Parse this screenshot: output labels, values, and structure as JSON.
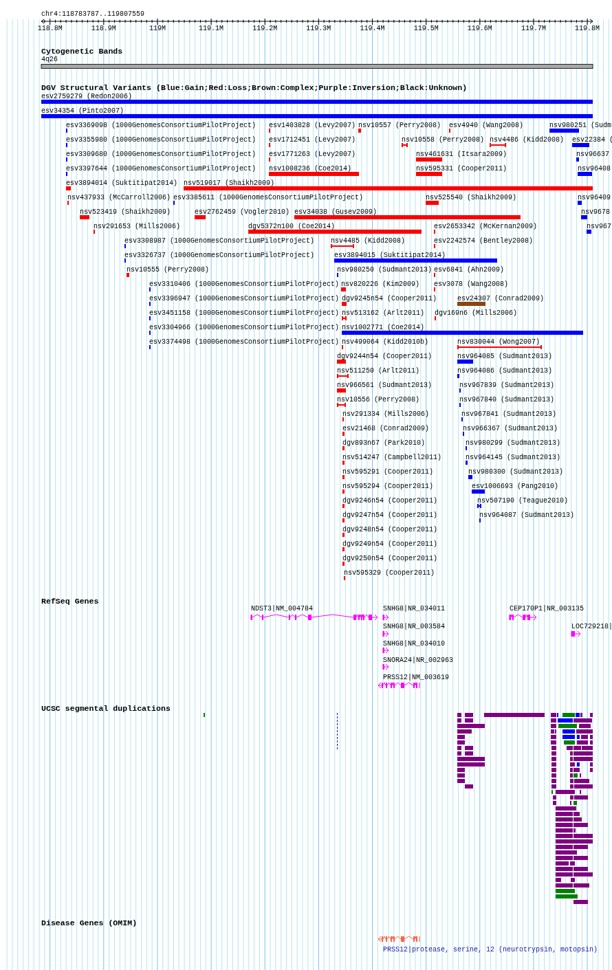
{
  "ruler": {
    "title": "chr4:118783787..119807559",
    "ticks": [
      "118.8M",
      "118.9M",
      "119M",
      "119.1M",
      "119.2M",
      "119.3M",
      "119.4M",
      "119.5M",
      "119.6M",
      "119.7M",
      "119.8M"
    ]
  },
  "cytogenetic_bands": {
    "title": "Cytogenetic Bands",
    "band": "4q26"
  },
  "dgv": {
    "title": "DGV Structural Variants (Blue:Gain;Red:Loss;Brown:Complex;Purple:Inversion;Black:Unknown)",
    "rows": [
      {
        "variants": [
          {
            "label": "esv2759279 (Redon2006)",
            "color": "#0000ff"
          }
        ]
      },
      {
        "variants": [
          {
            "label": "esv34354 (Pinto2007)",
            "color": "#0000ff"
          }
        ]
      },
      {
        "variants": [
          {
            "label": "esv3369098 (1000GenomesConsortiumPilotProject)",
            "color": "#0000ff"
          },
          {
            "label": "esv1403828 (Levy2007)",
            "color": "#ff0000"
          },
          {
            "label": "nsv10557 (Perry2008)",
            "color": "#ff0000"
          },
          {
            "label": "esv4940 (Wang2008)",
            "color": "#ff0000"
          },
          {
            "label": "nsv980251 (Sudm",
            "color": "#0000ff"
          }
        ]
      },
      {
        "variants": [
          {
            "label": "esv3355980 (1000GenomesConsortiumPilotProject)",
            "color": "#0000ff"
          },
          {
            "label": "esv1712451 (Levy2007)",
            "color": "#ff0000"
          },
          {
            "label": "nsv10558 (Perry2008)",
            "color": "#ff0000"
          },
          {
            "label": "nsv4486 (Kidd2008)",
            "color": "#ff0000"
          },
          {
            "label": "esv22384 (",
            "color": "#0000ff"
          }
        ]
      },
      {
        "variants": [
          {
            "label": "esv3309680 (1000GenomesConsortiumPilotProject)",
            "color": "#0000ff"
          },
          {
            "label": "esv1771263 (Levy2007)",
            "color": "#ff0000"
          },
          {
            "label": "nsv461631 (Itsara2009)",
            "color": "#ff0000"
          },
          {
            "label": "nsv96637",
            "color": "#0000ff"
          }
        ]
      },
      {
        "variants": [
          {
            "label": "esv3397644 (1000GenomesConsortiumPilotProject)",
            "color": "#0000ff"
          },
          {
            "label": "nsv1008236 (Coe2014)",
            "color": "#ff0000"
          },
          {
            "label": "nsv595331 (Cooper2011)",
            "color": "#ff0000"
          },
          {
            "label": "nsv96408",
            "color": "#0000ff"
          }
        ]
      },
      {
        "variants": [
          {
            "label": "esv3894014 (Suktitipat2014)",
            "color": "#ff0000"
          },
          {
            "label": "nsv519017 (Shaikh2009)",
            "color": "#ff0000"
          }
        ]
      },
      {
        "variants": [
          {
            "label": "nsv437933 (McCarroll2006)",
            "color": "#ff0000"
          },
          {
            "label": "esv3385611 (1000GenomesConsortiumPilotProject)",
            "color": "#0000ff"
          },
          {
            "label": "nsv525540 (Shaikh2009)",
            "color": "#ff0000"
          },
          {
            "label": "nsv96409",
            "color": "#0000ff"
          }
        ]
      },
      {
        "variants": [
          {
            "label": "nsv523419 (Shaikh2009)",
            "color": "#ff0000"
          },
          {
            "label": "esv2762459 (Vogler2010)",
            "color": "#ff0000"
          },
          {
            "label": "esv34038 (Gusev2009)",
            "color": "#ff0000"
          },
          {
            "label": "nsv9678",
            "color": "#0000ff"
          }
        ]
      },
      {
        "variants": [
          {
            "label": "nsv291653 (Mills2006)",
            "color": "#ff0000"
          },
          {
            "label": "dgv5372n100 (Coe2014)",
            "color": "#ff0000"
          },
          {
            "label": "esv2653342 (McKernan2009)",
            "color": "#ff0000"
          },
          {
            "label": "nsv967",
            "color": "#0000ff"
          }
        ]
      },
      {
        "variants": [
          {
            "label": "esv3308987 (1000GenomesConsortiumPilotProject)",
            "color": "#0000ff"
          },
          {
            "label": "nsv4485 (Kidd2008)",
            "color": "#ff0000"
          },
          {
            "label": "esv2242574 (Bentley2008)",
            "color": "#ff0000"
          }
        ]
      },
      {
        "variants": [
          {
            "label": "esv3326737 (1000GenomesConsortiumPilotProject)",
            "color": "#0000ff"
          },
          {
            "label": "esv3894015 (Suktitipat2014)",
            "color": "#0000ff"
          }
        ]
      },
      {
        "variants": [
          {
            "label": "nsv10555 (Perry2008)",
            "color": "#ff0000"
          },
          {
            "label": "nsv980250 (Sudmant2013)",
            "color": "#0000ff"
          },
          {
            "label": "esv6841 (Ahn2009)",
            "color": "#ff0000"
          }
        ]
      },
      {
        "variants": [
          {
            "label": "esv3310406 (1000GenomesConsortiumPilotProject)",
            "color": "#0000ff"
          },
          {
            "label": "nsv820226 (Kim2009)",
            "color": "#ff0000"
          },
          {
            "label": "esv3078 (Wang2008)",
            "color": "#ff0000"
          }
        ]
      },
      {
        "variants": [
          {
            "label": "esv3396947 (1000GenomesConsortiumPilotProject)",
            "color": "#0000ff"
          },
          {
            "label": "dgv9245n54 (Cooper2011)",
            "color": "#ff0000"
          },
          {
            "label": "esv24307 (Conrad2009)",
            "color": "#8b4513"
          }
        ]
      },
      {
        "variants": [
          {
            "label": "esv3451158 (1000GenomesConsortiumPilotProject)",
            "color": "#0000ff"
          },
          {
            "label": "nsv513162 (Arlt2011)",
            "color": "#ff0000"
          },
          {
            "label": "dgv169n6 (Mills2006)",
            "color": "#ff0000"
          }
        ]
      },
      {
        "variants": [
          {
            "label": "esv3304966 (1000GenomesConsortiumPilotProject)",
            "color": "#0000ff"
          },
          {
            "label": "nsv1002771 (Coe2014)",
            "color": "#0000ff"
          }
        ]
      },
      {
        "variants": [
          {
            "label": "esv3374498 (1000GenomesConsortiumPilotProject)",
            "color": "#0000ff"
          },
          {
            "label": "nsv499064 (Kidd2010b)",
            "color": "#ff0000"
          },
          {
            "label": "nsv830044 (Wong2007)",
            "color": "#ff0000"
          }
        ]
      },
      {
        "variants": [
          {
            "label": "dgv9244n54 (Cooper2011)",
            "color": "#ff0000"
          },
          {
            "label": "nsv964085 (Sudmant2013)",
            "color": "#0000ff"
          }
        ]
      },
      {
        "variants": [
          {
            "label": "nsv511250 (Arlt2011)",
            "color": "#ff0000"
          },
          {
            "label": "nsv964086 (Sudmant2013)",
            "color": "#0000ff"
          }
        ]
      },
      {
        "variants": [
          {
            "label": "nsv966561 (Sudmant2013)",
            "color": "#ff0000"
          },
          {
            "label": "nsv967839 (Sudmant2013)",
            "color": "#0000ff"
          }
        ]
      },
      {
        "variants": [
          {
            "label": "nsv10556 (Perry2008)",
            "color": "#ff0000"
          },
          {
            "label": "nsv967840 (Sudmant2013)",
            "color": "#0000ff"
          }
        ]
      },
      {
        "variants": [
          {
            "label": "nsv291334 (Mills2006)",
            "color": "#ff0000"
          },
          {
            "label": "nsv967841 (Sudmant2013)",
            "color": "#0000ff"
          }
        ]
      },
      {
        "variants": [
          {
            "label": "esv21468 (Conrad2009)",
            "color": "#ff0000"
          },
          {
            "label": "nsv966367 (Sudmant2013)",
            "color": "#0000ff"
          }
        ]
      },
      {
        "variants": [
          {
            "label": "dgv893n67 (Park2010)",
            "color": "#ff0000"
          },
          {
            "label": "nsv980299 (Sudmant2013)",
            "color": "#0000ff"
          }
        ]
      },
      {
        "variants": [
          {
            "label": "nsv514247 (Campbell2011)",
            "color": "#ff0000"
          },
          {
            "label": "nsv964145 (Sudmant2013)",
            "color": "#0000ff"
          }
        ]
      },
      {
        "variants": [
          {
            "label": "nsv595291 (Cooper2011)",
            "color": "#ff0000"
          },
          {
            "label": "nsv980300 (Sudmant2013)",
            "color": "#0000ff"
          }
        ]
      },
      {
        "variants": [
          {
            "label": "nsv595294 (Cooper2011)",
            "color": "#ff0000"
          },
          {
            "label": "esv1006693 (Pang2010)",
            "color": "#0000ff"
          }
        ]
      },
      {
        "variants": [
          {
            "label": "dgv9246n54 (Cooper2011)",
            "color": "#ff0000"
          },
          {
            "label": "nsv507190 (Teague2010)",
            "color": "#0000ff"
          }
        ]
      },
      {
        "variants": [
          {
            "label": "dgv9247n54 (Cooper2011)",
            "color": "#ff0000"
          },
          {
            "label": "nsv964087 (Sudmant2013)",
            "color": "#0000ff"
          }
        ]
      },
      {
        "variants": [
          {
            "label": "dgv9248n54 (Cooper2011)",
            "color": "#ff0000"
          }
        ]
      },
      {
        "variants": [
          {
            "label": "dgv9249n54 (Cooper2011)",
            "color": "#ff0000"
          }
        ]
      },
      {
        "variants": [
          {
            "label": "dgv9250n54 (Cooper2011)",
            "color": "#ff0000"
          }
        ]
      },
      {
        "variants": [
          {
            "label": "nsv595329 (Cooper2011)",
            "color": "#ff0000"
          }
        ]
      }
    ]
  },
  "refseq_genes": {
    "title": "RefSeq Genes",
    "genes": [
      {
        "label": "NDST3|NM_004784"
      },
      {
        "label": "SNHG8|NR_034011"
      },
      {
        "label": "CEP170P1|NR_003135"
      },
      {
        "label": "SNHG8|NR_003584"
      },
      {
        "label": "LOC729218|"
      },
      {
        "label": "SNHG8|NR_034010"
      },
      {
        "label": "SNORA24|NR_002963"
      },
      {
        "label": "PRSS12|NM_003619"
      }
    ]
  },
  "segmental_duplications": {
    "title": "UCSC segmental duplications"
  },
  "disease_genes": {
    "title": "Disease Genes (OMIM)",
    "genes": [
      {
        "label": "PRSS12|protease, serine, 12 (neurotrypsin, motopsin)"
      }
    ]
  }
}
